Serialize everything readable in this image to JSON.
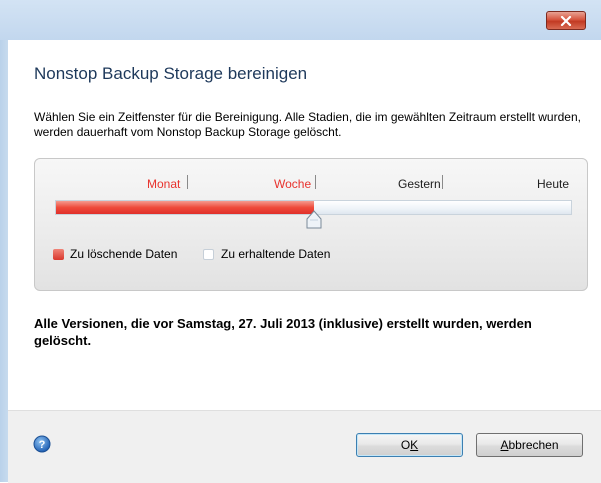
{
  "window": {
    "close_icon": "close-x-icon"
  },
  "dialog": {
    "title": "Nonstop Backup Storage bereinigen",
    "description": "Wählen Sie ein Zeitfenster für die Bereinigung. Alle Stadien, die im gewählten Zeitraum erstellt wurden, werden dauerhaft vom Nonstop Backup Storage gelöscht."
  },
  "slider": {
    "ticks": [
      {
        "label": "Monat",
        "state": "delete"
      },
      {
        "label": "Woche",
        "state": "delete"
      },
      {
        "label": "Gestern",
        "state": "keep"
      },
      {
        "label": "Heute",
        "state": "keep"
      }
    ],
    "selected": "Woche",
    "fill_fraction": 0.5,
    "colors": {
      "delete": "#e8332e",
      "keep": "#ffffff"
    }
  },
  "legend": {
    "delete_label": "Zu löschende Daten",
    "keep_label": "Zu erhaltende Daten"
  },
  "result": {
    "message": "Alle Versionen, die vor Samstag, 27. Juli 2013 (inklusive) erstellt wurden, werden gelöscht."
  },
  "footer": {
    "help_icon": "help-icon",
    "ok_prefix": "O",
    "ok_mnemonic": "K",
    "cancel_mnemonic": "A",
    "cancel_rest": "bbrechen"
  }
}
